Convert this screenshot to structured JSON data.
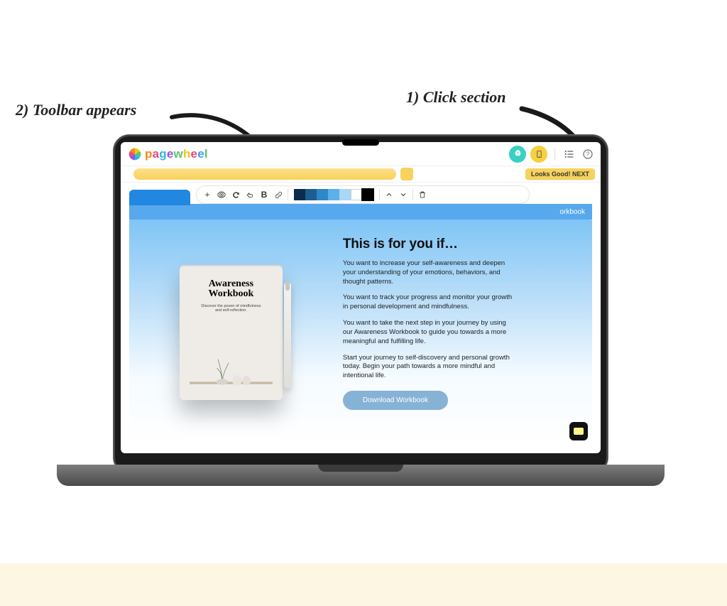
{
  "annotations": {
    "step1": "1) Click section",
    "step2": "2) Toolbar appears"
  },
  "brand": {
    "name": "pagewheel",
    "chars": [
      "p",
      "a",
      "g",
      "e",
      "w",
      "h",
      "e",
      "e",
      "l"
    ]
  },
  "header": {
    "icons": {
      "rocket": "rocket-icon",
      "phone": "phone-icon",
      "list": "list-icon",
      "help": "help-icon"
    }
  },
  "topstrip": {
    "next_label": "Looks Good! NEXT"
  },
  "toolbar": {
    "buttons": {
      "add": "+",
      "eye": "eye",
      "refresh": "refresh",
      "undo": "undo",
      "bold": "B",
      "link": "link",
      "up": "up",
      "down": "down",
      "trash": "trash"
    },
    "swatches": [
      "#0a2d4f",
      "#1e5e8e",
      "#2d88c7",
      "#5db0ea",
      "#a9d7f6",
      "#ffffff",
      "#000000"
    ]
  },
  "section_tab": "orkbook",
  "content": {
    "book": {
      "title_line1": "Awareness",
      "title_line2": "Workbook",
      "subtitle": "Discover the power of mindfulness and self-reflection."
    },
    "heading": "This is for you if…",
    "p1": "You want to increase your self-awareness and deepen your understanding of your emotions, behaviors, and thought patterns.",
    "p2": "You want to track your progress and monitor your growth in personal development and mindfulness.",
    "p3": "You want to take the next step in your journey by using our Awareness Workbook to guide you towards a more meaningful and fulfilling life.",
    "p4": "Start your journey to self-discovery and personal growth today. Begin your path towards a more mindful and intentional life.",
    "cta": "Download Workbook"
  }
}
